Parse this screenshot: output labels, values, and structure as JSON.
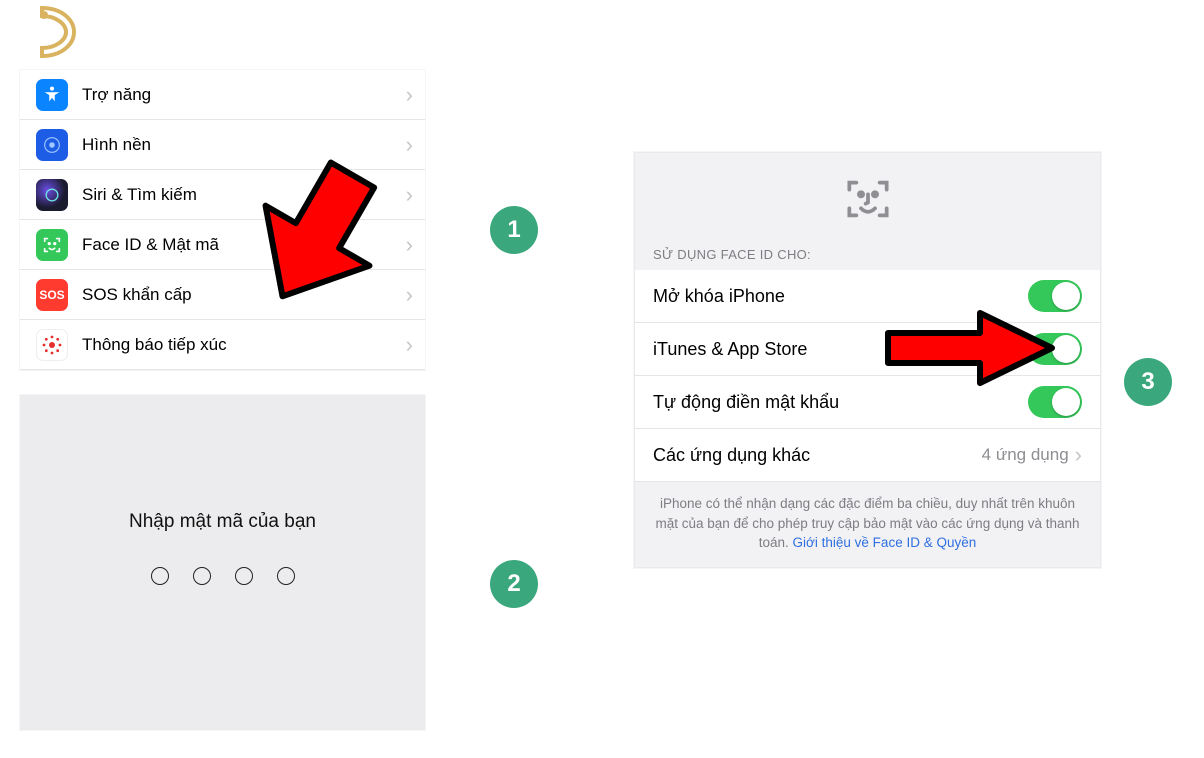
{
  "steps": {
    "s1": "1",
    "s2": "2",
    "s3": "3"
  },
  "panel1": {
    "items": [
      {
        "label": "Trợ năng"
      },
      {
        "label": "Hình nền"
      },
      {
        "label": "Siri & Tìm kiếm"
      },
      {
        "label": "Face ID & Mật mã"
      },
      {
        "label": "SOS khẩn cấp"
      },
      {
        "label": "Thông báo tiếp xúc"
      }
    ],
    "sos": "SOS"
  },
  "panel2": {
    "title": "Nhập mật mã của bạn"
  },
  "panel3": {
    "section_header": "SỬ DỤNG FACE ID CHO:",
    "rows": {
      "unlock": {
        "label": "Mở khóa iPhone"
      },
      "itunes": {
        "label": "iTunes & App Store"
      },
      "autofill": {
        "label": "Tự động điền mật khẩu"
      },
      "other": {
        "label": "Các ứng dụng khác",
        "detail": "4 ứng dụng"
      }
    },
    "footer": {
      "text": "iPhone có thể nhận dạng các đặc điểm ba chiều, duy nhất trên khuôn mặt của bạn để cho phép truy cập bảo mật vào các ứng dụng và thanh toán. ",
      "link": "Giới thiệu về Face ID & Quyền"
    }
  }
}
